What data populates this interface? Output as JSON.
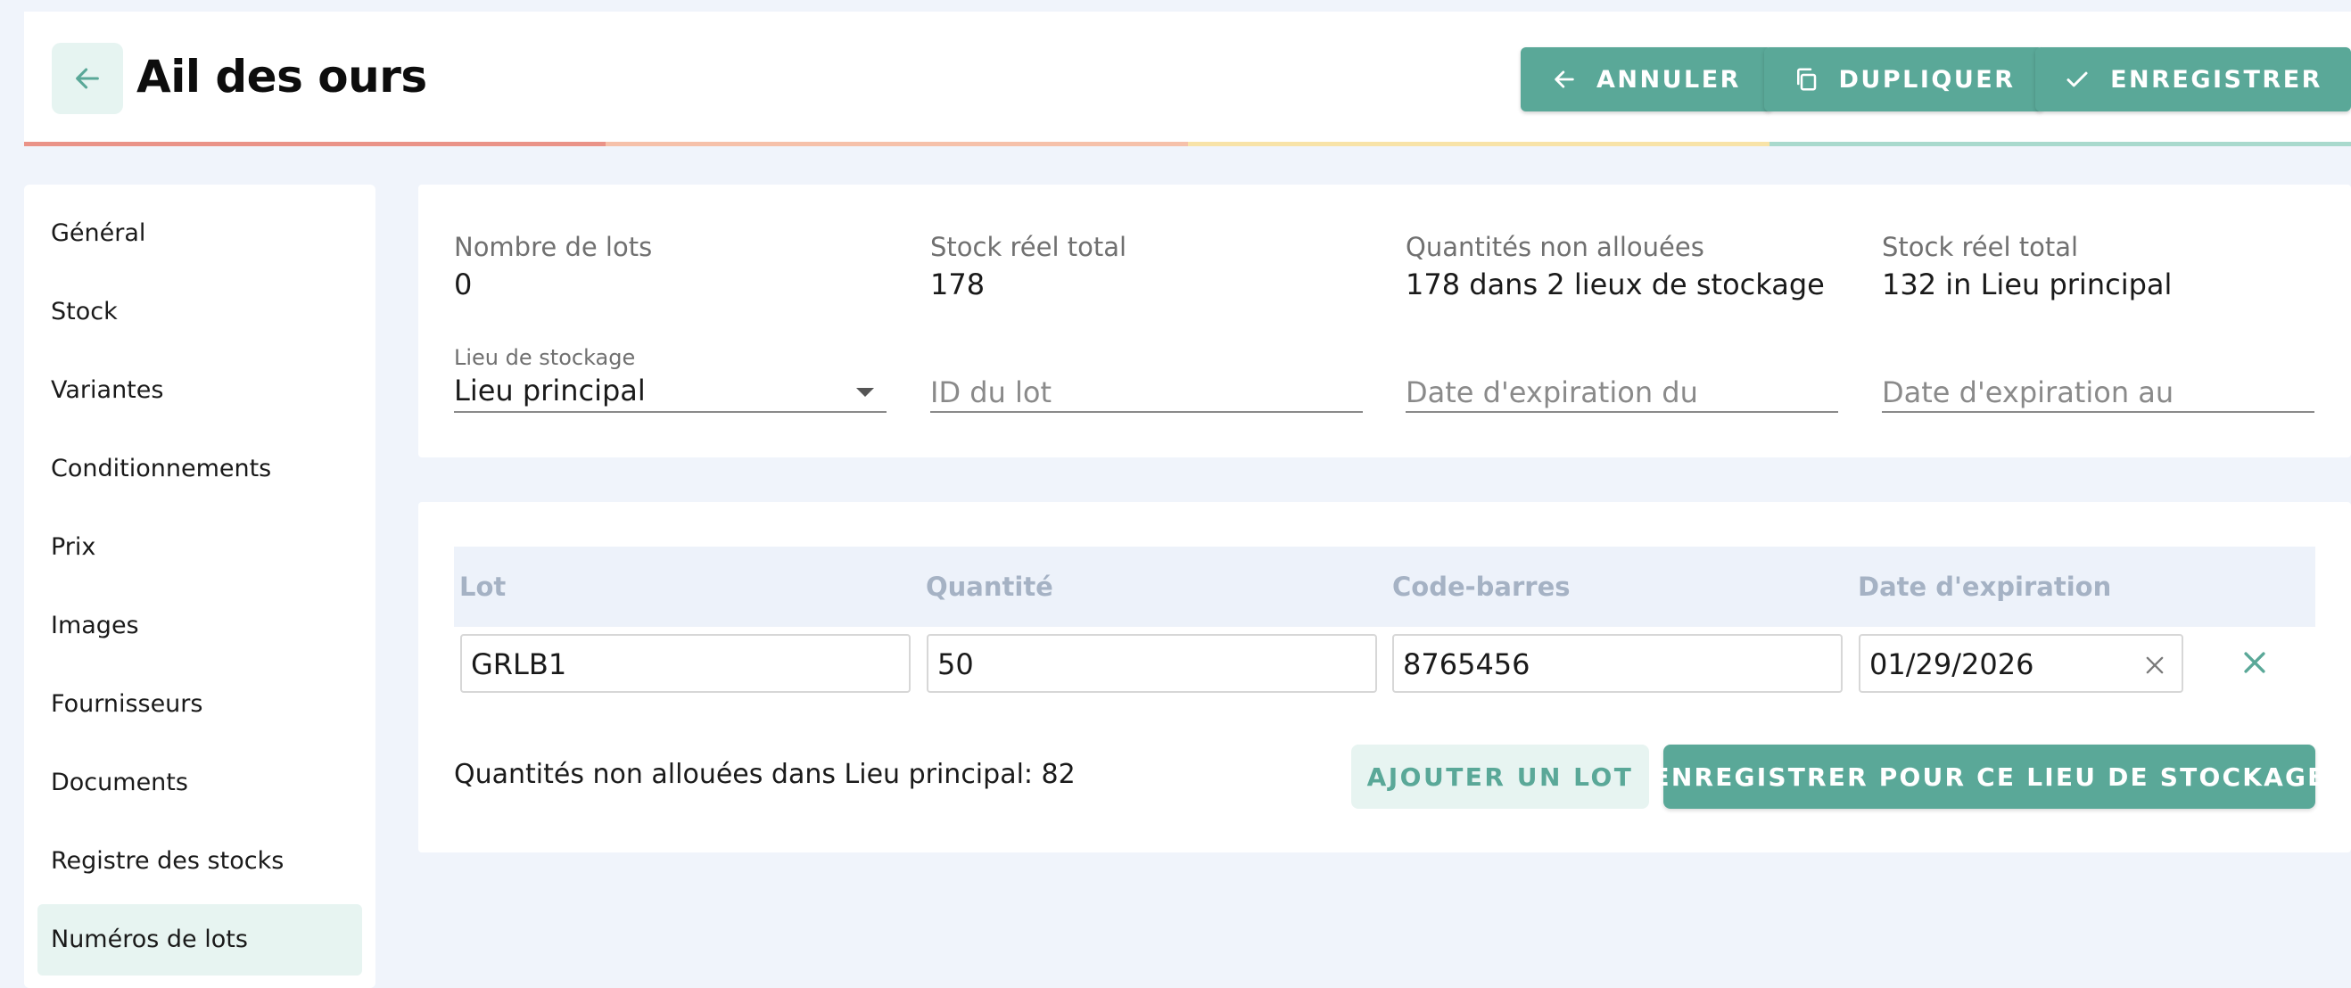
{
  "header": {
    "title": "Ail des ours",
    "cancel_label": "ANNULER",
    "duplicate_label": "DUPLIQUER",
    "save_label": "ENREGISTRER",
    "accent_colors": [
      "#ea9388",
      "#f6c1aa",
      "#f8e3a8",
      "#a9d9cd"
    ]
  },
  "sidebar": {
    "items": [
      {
        "label": "Général"
      },
      {
        "label": "Stock"
      },
      {
        "label": "Variantes"
      },
      {
        "label": "Conditionnements"
      },
      {
        "label": "Prix"
      },
      {
        "label": "Images"
      },
      {
        "label": "Fournisseurs"
      },
      {
        "label": "Documents"
      },
      {
        "label": "Registre des stocks"
      },
      {
        "label": "Numéros de lots"
      }
    ],
    "active": "Numéros de lots"
  },
  "summary": {
    "stats": [
      {
        "label": "Nombre de lots",
        "value": "0"
      },
      {
        "label": "Stock réel total",
        "value": "178"
      },
      {
        "label": "Quantités non allouées",
        "value": "178 dans 2 lieux de stockage"
      },
      {
        "label": "Stock réel total",
        "value": "132 in Lieu principal"
      }
    ],
    "filters": {
      "location_label": "Lieu de stockage",
      "location_value": "Lieu principal",
      "lot_id_placeholder": "ID du lot",
      "exp_from_placeholder": "Date d'expiration du",
      "exp_to_placeholder": "Date d'expiration au"
    }
  },
  "lots_table": {
    "headers": [
      "Lot",
      "Quantité",
      "Code-barres",
      "Date d'expiration"
    ],
    "rows": [
      {
        "lot": "GRLB1",
        "quantity": "50",
        "barcode": "8765456",
        "expiration": "01/29/2026"
      }
    ],
    "unallocated_text": "Quantités non allouées dans Lieu principal: 82",
    "add_lot_label": "AJOUTER UN LOT",
    "save_location_label": "ENREGISTRER POUR CE LIEU DE STOCKAGE"
  },
  "colors": {
    "primary": "#5aa898",
    "primary_light": "#e7f4f1",
    "page_bg": "#f0f4fb"
  }
}
